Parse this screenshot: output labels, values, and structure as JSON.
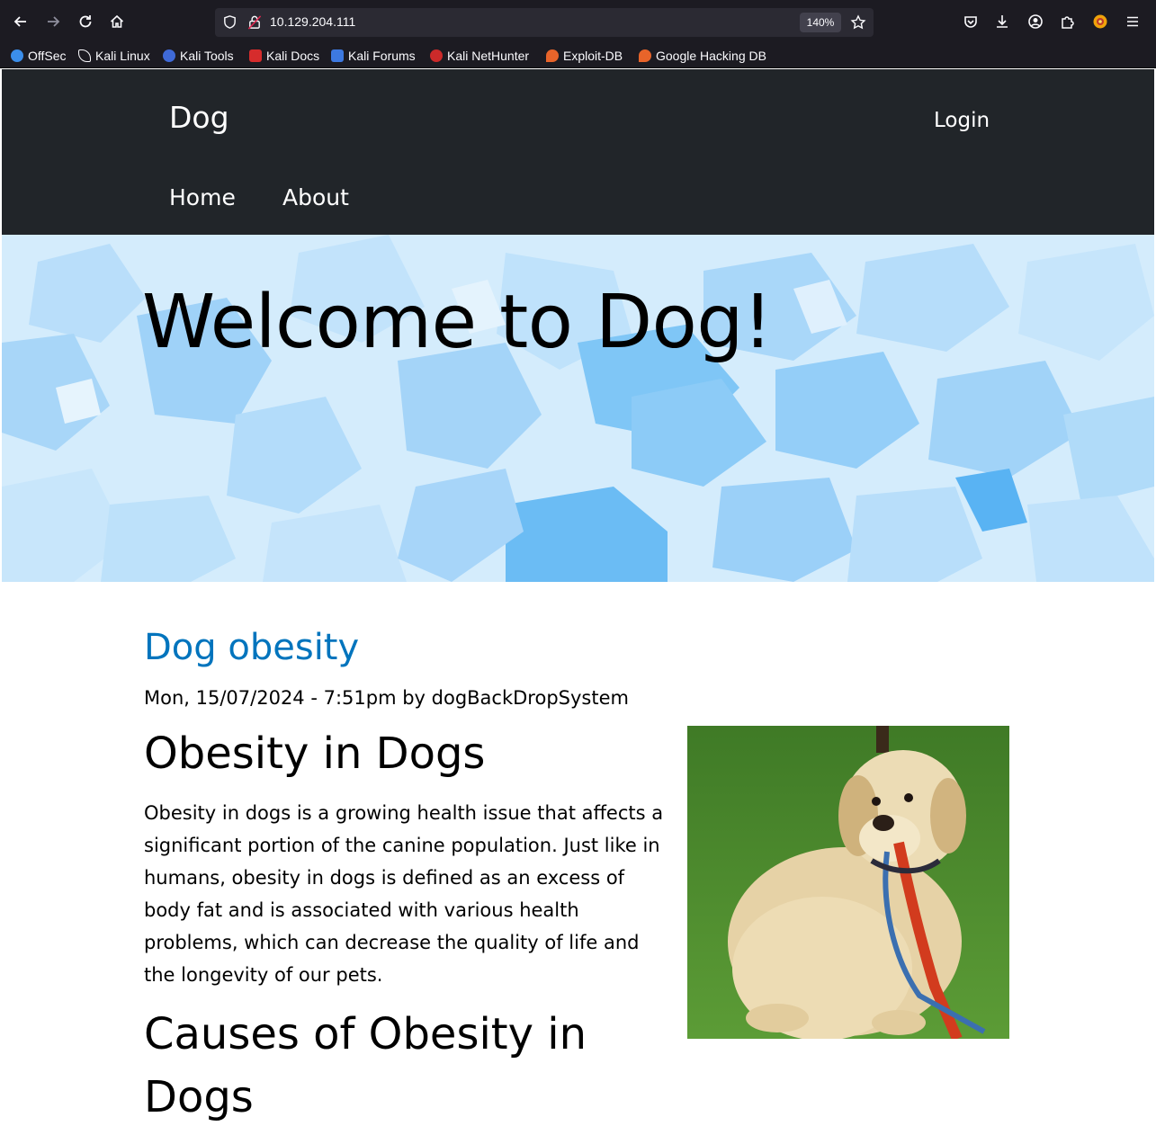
{
  "browser": {
    "url": "10.129.204.111",
    "zoom": "140%",
    "bookmarks": [
      {
        "label": "OffSec",
        "icon": "offsec-icon",
        "color": "#3b8eea"
      },
      {
        "label": "Kali Linux",
        "icon": "kali-dragon-icon",
        "color": "#2b2a33"
      },
      {
        "label": "Kali Tools",
        "icon": "kali-tools-icon",
        "color": "#3f6ad8"
      },
      {
        "label": "Kali Docs",
        "icon": "kali-docs-icon",
        "color": "#d62c2c"
      },
      {
        "label": "Kali Forums",
        "icon": "kali-forums-icon",
        "color": "#3d79e0"
      },
      {
        "label": "Kali NetHunter",
        "icon": "nethunter-icon",
        "color": "#cc2a2a"
      },
      {
        "label": "Exploit-DB",
        "icon": "exploitdb-icon",
        "color": "#e8642a"
      },
      {
        "label": "Google Hacking DB",
        "icon": "ghdb-icon",
        "color": "#e8642a"
      }
    ]
  },
  "site": {
    "name": "Dog",
    "login": "Login",
    "nav": [
      "Home",
      "About"
    ],
    "hero_title": "Welcome to Dog!"
  },
  "article": {
    "title": "Dog obesity",
    "meta": "Mon, 15/07/2024 - 7:51pm by dogBackDropSystem",
    "heading1": "Obesity in Dogs",
    "paragraph": "Obesity in dogs is a growing health issue that affects a significant portion of the canine population. Just like in humans, obesity in dogs is defined as an excess of body fat and is associated with various health problems, which can decrease the quality of life and the longevity of our pets.",
    "heading2": "Causes of Obesity in Dogs"
  },
  "colors": {
    "header_bg": "#212529",
    "link": "#0074bd",
    "hero_base": "#cfe9fb"
  }
}
